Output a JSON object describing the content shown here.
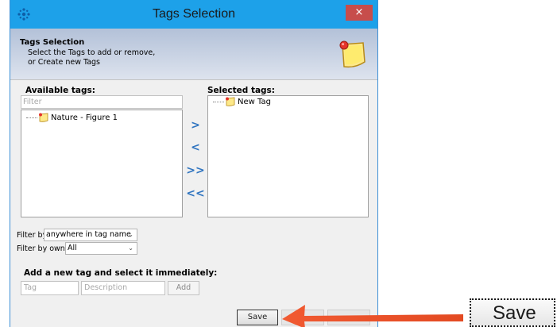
{
  "window": {
    "title": "Tags Selection",
    "close_glyph": "×"
  },
  "header": {
    "title": "Tags Selection",
    "subtitle_line1": "Select the Tags to add or remove,",
    "subtitle_line2": "or Create new Tags",
    "icon": "sticky-note-icon"
  },
  "available": {
    "label": "Available tags:",
    "filter_placeholder": "Filter",
    "items": [
      "Nature - Figure 1"
    ]
  },
  "selected": {
    "label": "Selected tags:",
    "items": [
      "New Tag"
    ]
  },
  "transfer_buttons": {
    "add": ">",
    "remove": "<",
    "add_all": ">>",
    "remove_all": "<<"
  },
  "filters": {
    "filter_by_label": "Filter by",
    "filter_by_value": "anywhere in tag name",
    "filter_by_owner_label": "Filter by owner",
    "filter_by_owner_value": "All"
  },
  "new_tag": {
    "label": "Add a new tag and select it immediately:",
    "tag_placeholder": "Tag",
    "description_placeholder": "Description",
    "add_label": "Add"
  },
  "footer": {
    "save_label": "Save"
  },
  "zoom": {
    "save_label": "Save"
  },
  "colors": {
    "titlebar": "#1da1e9",
    "close": "#c74d4b",
    "arrow": "#e8512c",
    "transfer": "#2f74c0"
  }
}
